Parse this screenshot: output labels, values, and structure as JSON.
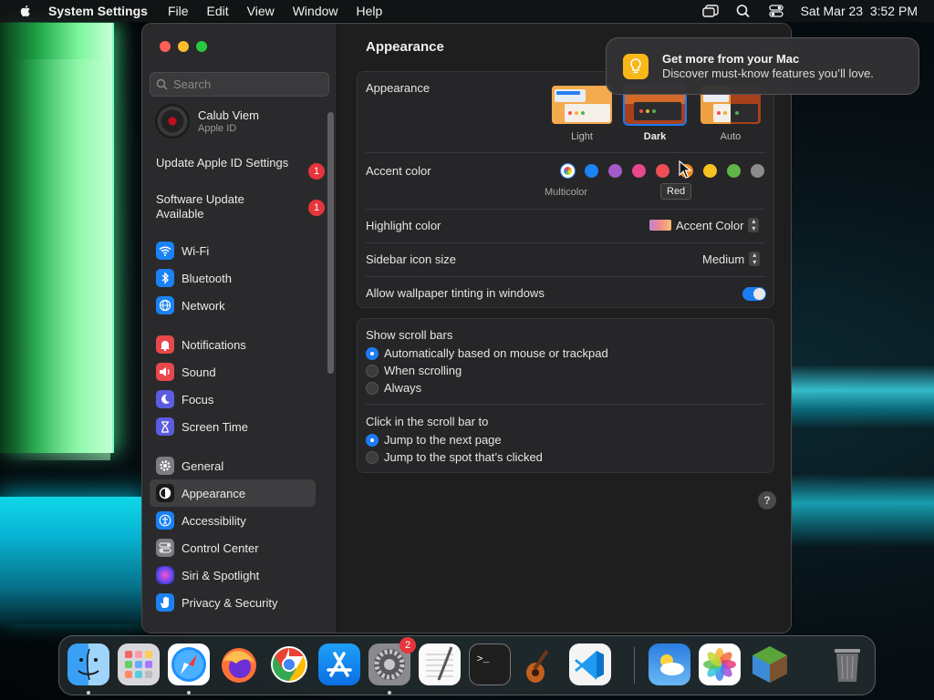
{
  "menubar": {
    "app_name": "System Settings",
    "menus": [
      "File",
      "Edit",
      "View",
      "Window",
      "Help"
    ],
    "clock": "Sat Mar 23  3:52 PM"
  },
  "sidebar": {
    "search_placeholder": "Search",
    "profile": {
      "name": "Calub Viem",
      "subtitle": "Apple ID"
    },
    "notices": [
      {
        "label": "Update Apple ID Settings",
        "badge": "1"
      },
      {
        "label": "Software Update Available",
        "badge": "1"
      }
    ],
    "group1": [
      {
        "label": "Wi-Fi",
        "icon": "wifi-icon",
        "color": "#1a82f5"
      },
      {
        "label": "Bluetooth",
        "icon": "bluetooth-icon",
        "color": "#1a82f5"
      },
      {
        "label": "Network",
        "icon": "globe-icon",
        "color": "#1a82f5"
      }
    ],
    "group2": [
      {
        "label": "Notifications",
        "icon": "bell-icon",
        "color": "#e8484b"
      },
      {
        "label": "Sound",
        "icon": "speaker-icon",
        "color": "#e8484b"
      },
      {
        "label": "Focus",
        "icon": "moon-icon",
        "color": "#5b5ce0"
      },
      {
        "label": "Screen Time",
        "icon": "hourglass-icon",
        "color": "#5b5ce0"
      }
    ],
    "group3": [
      {
        "label": "General",
        "icon": "gear-icon",
        "color": "#7d7d82"
      },
      {
        "label": "Appearance",
        "icon": "appearance-icon",
        "color": "#1a1a1a",
        "selected": true
      },
      {
        "label": "Accessibility",
        "icon": "accessibility-icon",
        "color": "#1a82f5"
      },
      {
        "label": "Control Center",
        "icon": "control-center-icon",
        "color": "#7d7d82"
      },
      {
        "label": "Siri & Spotlight",
        "icon": "siri-icon",
        "color": "#9b3bd6"
      },
      {
        "label": "Privacy & Security",
        "icon": "hand-icon",
        "color": "#1a82f5"
      }
    ]
  },
  "content": {
    "title": "Appearance",
    "appearance": {
      "label": "Appearance",
      "options": [
        {
          "label": "Light",
          "selected": false
        },
        {
          "label": "Dark",
          "selected": true
        },
        {
          "label": "Auto",
          "selected": false
        }
      ]
    },
    "accent": {
      "label": "Accent color",
      "swatches": [
        {
          "name": "multicolor",
          "color": "multicolor"
        },
        {
          "name": "blue",
          "color": "#1a82f5"
        },
        {
          "name": "purple",
          "color": "#a35bcb"
        },
        {
          "name": "pink",
          "color": "#e9488f"
        },
        {
          "name": "red",
          "color": "#ee4e53"
        },
        {
          "name": "orange",
          "color": "#f38a23"
        },
        {
          "name": "yellow",
          "color": "#f6c221"
        },
        {
          "name": "green",
          "color": "#5fb548"
        },
        {
          "name": "graphite",
          "color": "#8c8c8c"
        }
      ],
      "selected_caption": "Multicolor",
      "tooltip": "Red"
    },
    "highlight": {
      "label": "Highlight color",
      "value": "Accent Color"
    },
    "sidebar_icon": {
      "label": "Sidebar icon size",
      "value": "Medium"
    },
    "tinting": {
      "label": "Allow wallpaper tinting in windows",
      "enabled": true
    },
    "scroll_bars": {
      "label": "Show scroll bars",
      "options": [
        {
          "label": "Automatically based on mouse or trackpad",
          "selected": true
        },
        {
          "label": "When scrolling",
          "selected": false
        },
        {
          "label": "Always",
          "selected": false
        }
      ]
    },
    "click_scroll": {
      "label": "Click in the scroll bar to",
      "options": [
        {
          "label": "Jump to the next page",
          "selected": true
        },
        {
          "label": "Jump to the spot that’s clicked",
          "selected": false
        }
      ]
    },
    "help": "?"
  },
  "notification": {
    "title": "Get more from your Mac",
    "body": "Discover must-know features you’ll love."
  },
  "dock": {
    "apps": [
      {
        "name": "finder",
        "running": true
      },
      {
        "name": "launchpad",
        "running": false
      },
      {
        "name": "safari",
        "running": true
      },
      {
        "name": "firefox",
        "running": false
      },
      {
        "name": "chrome",
        "running": false
      },
      {
        "name": "app-store",
        "running": false
      },
      {
        "name": "system-settings",
        "running": true,
        "badge": "2"
      },
      {
        "name": "textedit",
        "running": false
      },
      {
        "name": "terminal",
        "running": false
      },
      {
        "name": "garageband",
        "running": false
      },
      {
        "name": "vscode",
        "running": false
      },
      {
        "name": "weather",
        "running": false
      },
      {
        "name": "photos",
        "running": false
      },
      {
        "name": "minecraft",
        "running": false
      },
      {
        "name": "trash",
        "running": false
      }
    ]
  }
}
